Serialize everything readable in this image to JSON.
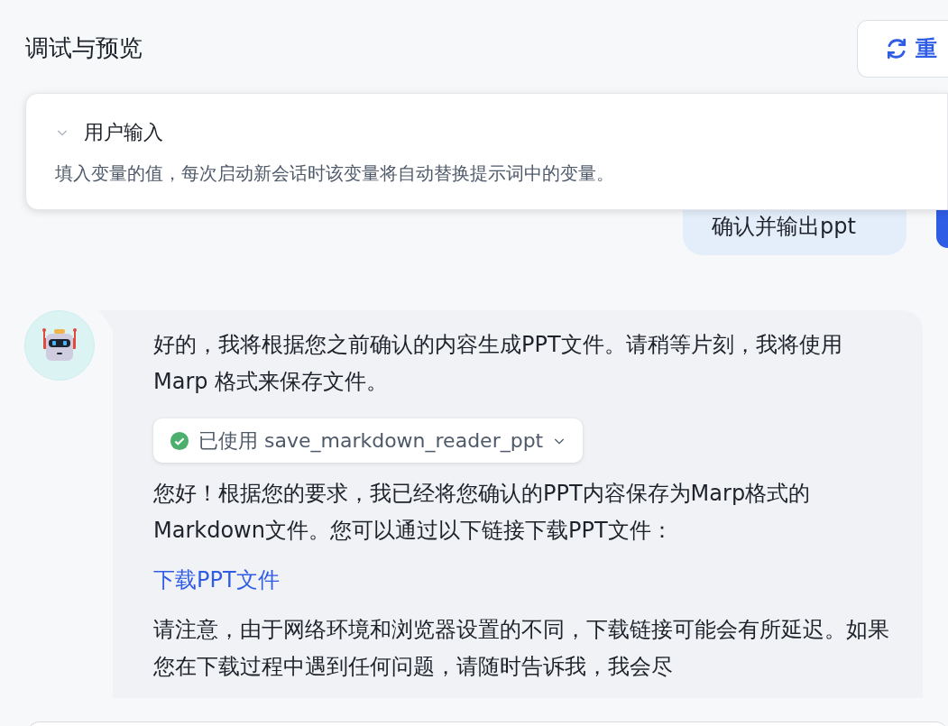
{
  "header": {
    "title": "调试与预览",
    "refresh_button": {
      "label": "重"
    }
  },
  "user_input_panel": {
    "title": "用户输入",
    "expanded": true,
    "description": "填入变量的值，每次启动新会话时该变量将自动替换提示词中的变量。"
  },
  "messages": [
    {
      "kind": "user",
      "text": "确认并输出ppt"
    },
    {
      "kind": "bot",
      "blocks": [
        {
          "kind": "paragraph",
          "text": "好的，我将根据您之前确认的内容生成PPT文件。请稍等片刻，我将使用 Marp 格式来保存文件。"
        },
        {
          "kind": "tool",
          "completed": true,
          "label": "已使用 save_markdown_reader_ppt"
        },
        {
          "kind": "paragraph",
          "text": "您好！根据您的要求，我已经将您确认的PPT内容保存为Marp格式的Markdown文件。您可以通过以下链接下载PPT文件："
        },
        {
          "kind": "link",
          "text": "下载PPT文件"
        },
        {
          "kind": "paragraph",
          "text": "请注意，由于网络环境和浏览器设置的不同，下载链接可能会有所延迟。如果您在下载过程中遇到任何问题，请随时告诉我，我会尽"
        }
      ]
    }
  ]
}
